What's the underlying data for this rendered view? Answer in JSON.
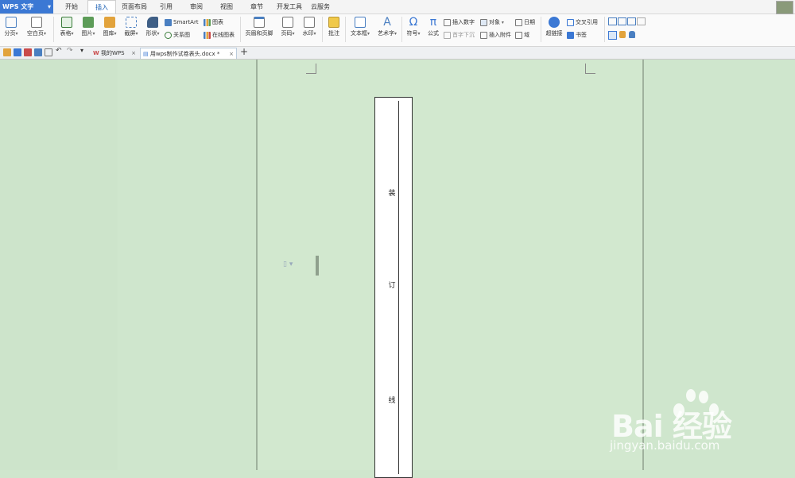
{
  "app": {
    "name": "WPS 文字"
  },
  "menu": {
    "tabs": [
      "开始",
      "插入",
      "页面布局",
      "引用",
      "审阅",
      "视图",
      "章节",
      "开发工具",
      "云服务"
    ],
    "active_tab": "插入"
  },
  "ribbon": {
    "page_break": "分页",
    "blank_page": "空白页",
    "table": "表格",
    "picture": "图片",
    "gallery": "图库",
    "screenshot": "截屏",
    "shape": "形状",
    "smartart": "SmartArt",
    "relation_chart": "关系图",
    "chart": "图表",
    "online_chart": "在线图表",
    "header_footer": "页眉和页脚",
    "page_number": "页码",
    "watermark": "水印",
    "comment": "批注",
    "textbox": "文本框",
    "wordart": "艺术字",
    "symbol": "符号",
    "formula": "公式",
    "insert_number": "插入数字",
    "object": "对象",
    "date": "日期",
    "drop_cap": "首字下沉",
    "attachment": "插入附件",
    "field": "域",
    "hyperlink": "超链接",
    "cross_ref": "交叉引用",
    "bookmark": "书签"
  },
  "doc_tabs": [
    {
      "label": "我的WPS",
      "active": false
    },
    {
      "label": "用wps制作试卷表头.docx *",
      "active": true
    }
  ],
  "document": {
    "binding_chars": [
      "装",
      "订",
      "线"
    ]
  },
  "watermark": {
    "brand": "Bai  经验",
    "url": "jingyan.baidu.com"
  },
  "colors": {
    "accent": "#3b78d4",
    "page_bg": "#d2e8cf",
    "workspace_bg": "#cfe6cd"
  }
}
